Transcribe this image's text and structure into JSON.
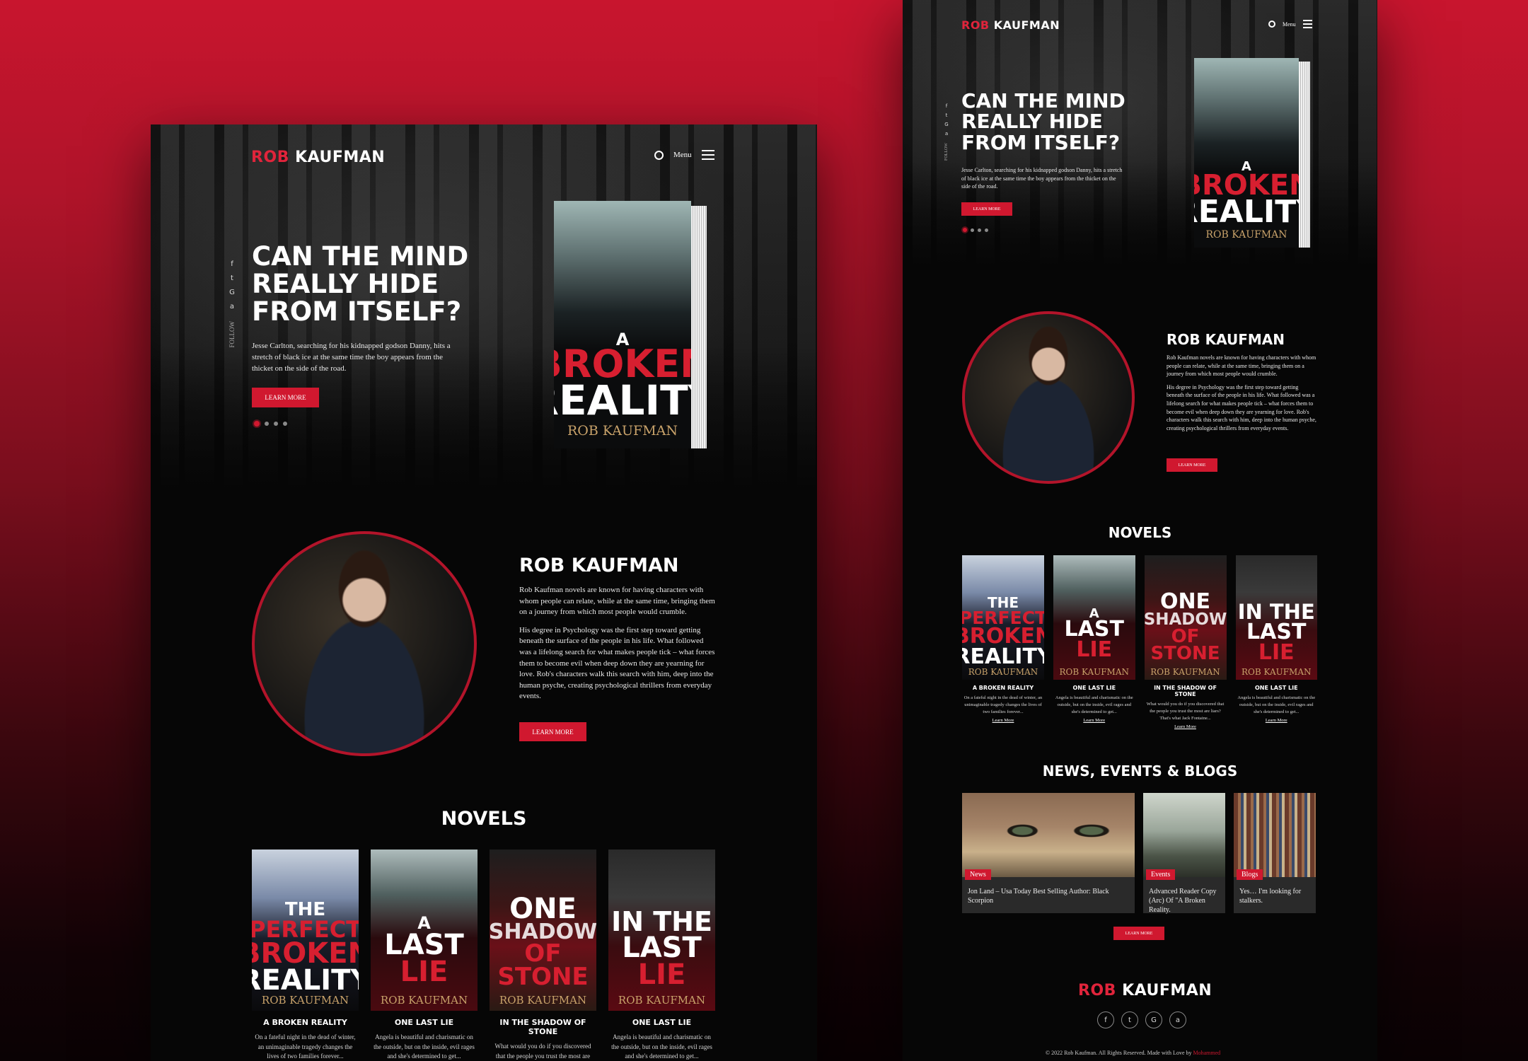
{
  "site": {
    "logo_first": "ROB",
    "logo_last": "KAUFMAN",
    "menu_label": "Menu"
  },
  "hero": {
    "headline": "CAN THE MIND REALLY HIDE FROM ITSELF?",
    "lead": "Jesse Carlton, searching for his kidnapped godson Danny, hits a stretch of black ice at the same time the boy appears from the thicket on the side of the road.",
    "button": "LEARN MORE",
    "follow_label": "FOLLOW",
    "social_icons": [
      "facebook-icon",
      "twitter-icon",
      "google-icon",
      "amazon-icon"
    ],
    "slides_total": 4,
    "slide_active": 1
  },
  "hero_book": {
    "line1": "A",
    "line2": "BROKEN",
    "line3": "REALITY",
    "author": "ROB KAUFMAN"
  },
  "about": {
    "title": "ROB KAUFMAN",
    "p1": "Rob Kaufman novels are known for having characters with whom people can relate, while at the same time, bringing them on a journey from which most people would crumble.",
    "p2": "His degree in Psychology was the first step toward getting beneath the surface of the people in his life. What followed was a lifelong search for what makes people tick – what forces them to become evil when deep down they are yearning for love. Rob's characters walk this search with him, deep into the human psyche, creating psychological thrillers from everyday events.",
    "button": "LEARN MORE"
  },
  "novels": {
    "heading": "NOVELS",
    "items": [
      {
        "cover_top": "THE",
        "cover_red": "PERFECT",
        "cover_line": "BROKEN",
        "cover_bottom": "REALITY",
        "author": "ROB KAUFMAN",
        "title": "A BROKEN REALITY",
        "desc": "On a fateful night in the dead of winter, an unimaginable tragedy changes the lives of two families forever...",
        "link": "Learn More"
      },
      {
        "cover_top": "A",
        "cover_red": "LIE",
        "cover_line": "LAST",
        "cover_bottom": "",
        "author": "ROB KAUFMAN",
        "title": "ONE LAST LIE",
        "desc": "Angela is beautiful and charismatic on the outside, but on the inside, evil rages and she's determined to get...",
        "link": "Learn More"
      },
      {
        "cover_top": "ONE",
        "cover_red": "OF STONE",
        "cover_line": "SHADOW",
        "cover_bottom": "",
        "author": "ROB KAUFMAN",
        "title": "IN THE SHADOW OF STONE",
        "desc": "What would you do if you discovered that the people you trust the most are liars? That's what Jack Fontaine...",
        "link": "Learn More"
      },
      {
        "cover_top": "IN THE",
        "cover_red": "LIE",
        "cover_line": "LAST",
        "cover_bottom": "",
        "author": "ROB KAUFMAN",
        "title": "ONE LAST LIE",
        "desc": "Angela is beautiful and charismatic on the outside, but on the inside, evil rages and she's determined to get...",
        "link": "Learn More"
      }
    ]
  },
  "news": {
    "heading": "NEWS, EVENTS & BLOGS",
    "items": [
      {
        "tag": "News",
        "caption": "Jon Land – Usa Today Best Selling Author: Black Scorpion"
      },
      {
        "tag": "Events",
        "caption": "Advanced Reader Copy (Arc) Of \"A Broken Reality."
      },
      {
        "tag": "Blogs",
        "caption": "Yes… I'm looking for stalkers."
      }
    ],
    "button": "LEARN MORE"
  },
  "footer": {
    "logo_first": "ROB",
    "logo_last": "KAUFMAN",
    "copyright": "© 2022 Rob Kaufman. All Rights Reserved. Made with Love by",
    "credit": "Mohammed"
  },
  "colors": {
    "accent": "#d0182f",
    "background": "#060606",
    "page_gradient_top": "#c8152e"
  }
}
